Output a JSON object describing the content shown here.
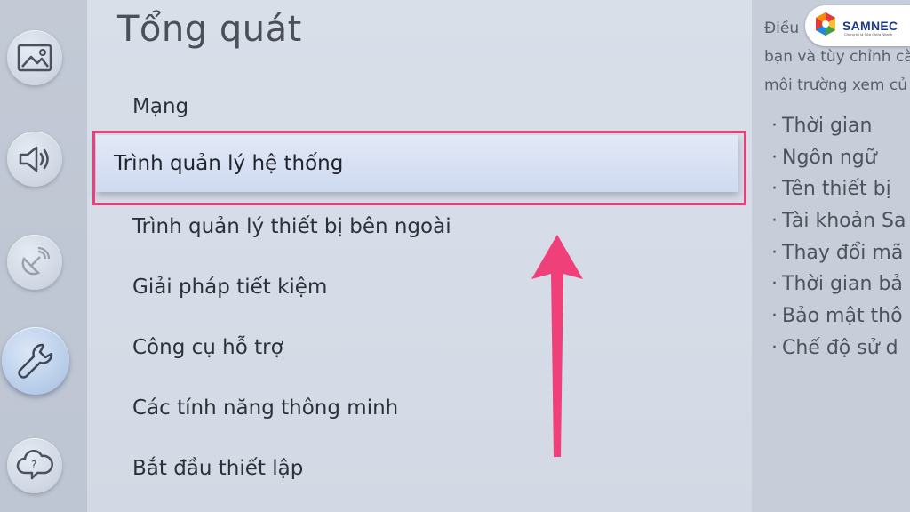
{
  "sidebar": {
    "items": [
      {
        "icon": "picture-icon",
        "label": ""
      },
      {
        "icon": "sound-icon",
        "label": ""
      },
      {
        "icon": "broadcast-icon",
        "label": ""
      },
      {
        "icon": "wrench-icon",
        "label": ""
      },
      {
        "icon": "support-cloud-icon",
        "label": ""
      }
    ]
  },
  "main": {
    "title": "Tổng quát",
    "menu": [
      {
        "label": "Mạng"
      },
      {
        "label": "Trình quản lý hệ thống",
        "focused": true
      },
      {
        "label": "Trình quản lý thiết bị bên ngoài"
      },
      {
        "label": "Giải pháp tiết kiệm"
      },
      {
        "label": "Công cụ hỗ trợ"
      },
      {
        "label": "Các tính năng thông minh"
      },
      {
        "label": "Bắt đầu thiết lập"
      }
    ]
  },
  "description": {
    "lines": [
      "Điều",
      "bạn và tùy chỉnh cà",
      "môi trường xem củ"
    ],
    "items": [
      "Thời gian",
      "Ngôn ngữ",
      "Tên thiết bị",
      "Tài khoản Sa",
      "Thay đổi mã",
      "Thời gian bả",
      "Bảo mật thô",
      "Chế độ sử d"
    ]
  },
  "logo": {
    "name": "SAMNEC",
    "tagline": "Chúng tôi là Sửa Chữa Nhanh"
  },
  "colors": {
    "highlight": "#e8407a",
    "arrow": "#f0407a",
    "brand": "#1b3a8f"
  }
}
